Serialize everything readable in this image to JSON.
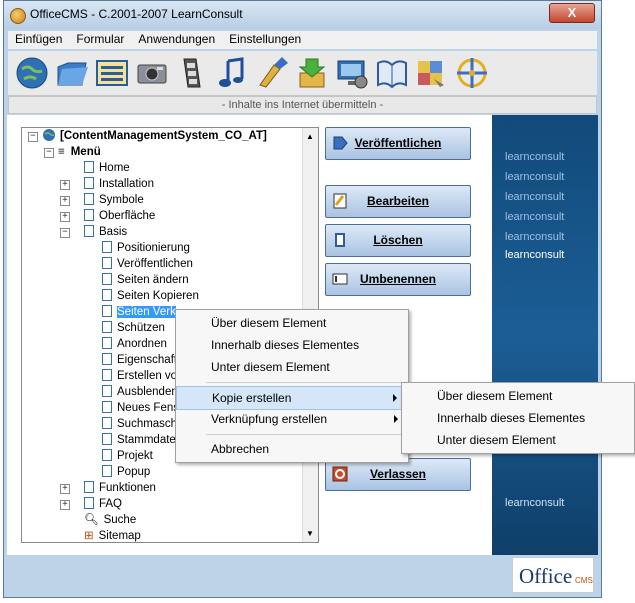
{
  "window": {
    "title": "OfficeCMS - C.2001-2007 LearnConsult",
    "close_label": "X"
  },
  "menubar": [
    "Einfügen",
    "Formular",
    "Anwendungen",
    "Einstellungen"
  ],
  "toolbar": [
    "globe-icon",
    "folder-icon",
    "list-icon",
    "camera-icon",
    "film-icon",
    "music-icon",
    "brush-icon",
    "download-icon",
    "screen-icon",
    "book-icon",
    "puzzle-icon",
    "compass-icon"
  ],
  "status": "- Inhalte ins Internet übermitteln -",
  "tree": {
    "root": "[ContentManagementSystem_CO_AT]",
    "menu": "Menü",
    "items": [
      "Home",
      "Installation",
      "Symbole",
      "Oberfläche",
      "Basis",
      "Positionierung",
      "Veröffentlichen",
      "Seiten ändern",
      "Seiten Kopieren",
      "Seiten Verk",
      "Schützen",
      "Anordnen",
      "Eigenschaft",
      "Erstellen vo",
      "Ausblenden",
      "Neues Fens",
      "Suchmasch",
      "Stammdater",
      "Projekt",
      "Popup",
      "Funktionen",
      "FAQ",
      "Suche",
      "Sitemap"
    ]
  },
  "buttons": {
    "publish": "Veröffentlichen",
    "edit": "Bearbeiten",
    "delete": "Löschen",
    "rename": "Umbenennen",
    "exit": "Verlassen"
  },
  "side_brand": "learnconsult",
  "office_logo": {
    "main": "Office",
    "sub": "CMS"
  },
  "context_menu": {
    "items": [
      "Über diesem Element",
      "Innerhalb dieses Elementes",
      "Unter diesem Element",
      "Kopie erstellen",
      "Verknüpfung erstellen",
      "Abbrechen"
    ]
  },
  "submenu": {
    "items": [
      "Über diesem Element",
      "Innerhalb dieses Elementes",
      "Unter diesem Element"
    ]
  }
}
